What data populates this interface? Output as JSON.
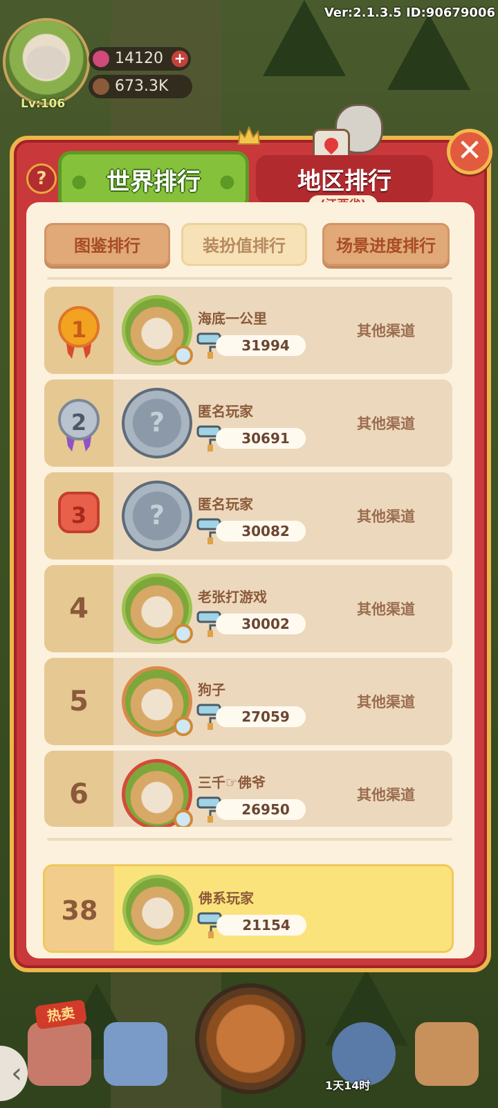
{
  "status": {
    "version_label": "Ver:2.1.3.5 ID:90679006",
    "level": "Lv:106",
    "gems": "14120",
    "coins": "673.3K",
    "add_symbol": "+"
  },
  "tabs": {
    "world": "世界排行",
    "region": "地区排行",
    "region_sub": "(江西省)",
    "help_symbol": "?",
    "close_symbol": "✕"
  },
  "subtabs": [
    {
      "label": "图鉴排行",
      "active": true
    },
    {
      "label": "装扮值排行",
      "active": false
    },
    {
      "label": "场景进度排行",
      "active": true
    }
  ],
  "rows": [
    {
      "rank": "1",
      "name": "海底一公里",
      "score": "31994",
      "channel": "其他渠道"
    },
    {
      "rank": "2",
      "name": "匿名玩家",
      "score": "30691",
      "channel": "其他渠道"
    },
    {
      "rank": "3",
      "name": "匿名玩家",
      "score": "30082",
      "channel": "其他渠道"
    },
    {
      "rank": "4",
      "name": "老张打游戏",
      "score": "30002",
      "channel": "其他渠道"
    },
    {
      "rank": "5",
      "name": "狗子",
      "score": "27059",
      "channel": "其他渠道"
    },
    {
      "rank": "6",
      "name": "三千☞佛爷",
      "score": "26950",
      "channel": "其他渠道"
    }
  ],
  "me": {
    "rank": "38",
    "name": "佛系玩家",
    "score": "21154"
  },
  "bottom": {
    "hot_label": "热卖",
    "timer": "1天14时",
    "anon_symbol": "?"
  },
  "colors": {
    "panel": "#c9383a",
    "gold_border": "#ecb64a",
    "world_tab": "#86c13b",
    "highlight_row": "#fbe37c"
  }
}
